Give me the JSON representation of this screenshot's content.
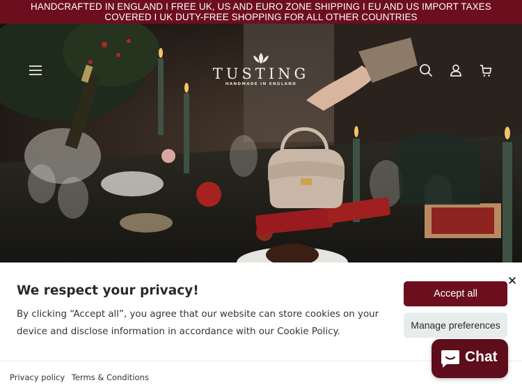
{
  "announcement": {
    "line1": "HANDCRAFTED IN ENGLAND I FREE UK, US AND EURO ZONE SHIPPING I EU AND US IMPORT TAXES",
    "line2": "COVERED I UK DUTY-FREE SHOPPING FOR ALL OTHER COUNTRIES"
  },
  "header": {
    "logo_word": "TUSTING",
    "logo_tagline": "HANDMADE IN ENGLAND",
    "icons": [
      "menu-icon",
      "search-icon",
      "account-icon",
      "cart-icon"
    ]
  },
  "cookie_banner": {
    "title": "We respect your privacy!",
    "body": "By clicking “Accept all”, you agree that our website can store cookies on your device and disclose information in accordance with our Cookie Policy.",
    "accept_label": "Accept all",
    "manage_label": "Manage preferences",
    "close_label": "✕",
    "links": [
      "Privacy policy",
      "Terms & Conditions"
    ]
  },
  "chat": {
    "label": "Chat"
  },
  "colors": {
    "brand": "#6d0e1f",
    "chat": "#5d0d1b",
    "manage_button": "#e8eceb"
  }
}
